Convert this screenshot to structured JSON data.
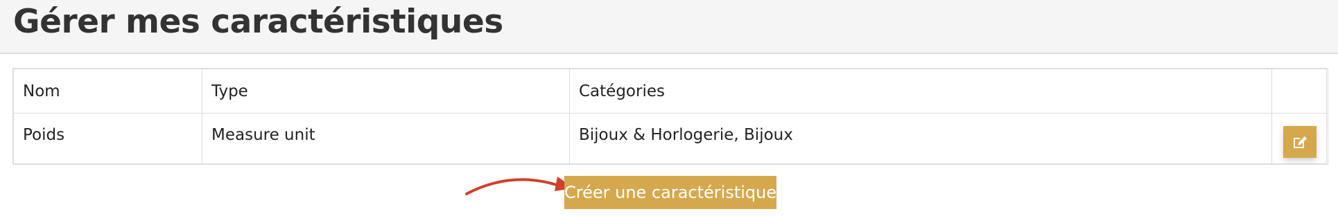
{
  "header": {
    "title": "Gérer mes caractéristiques"
  },
  "table": {
    "columns": [
      "Nom",
      "Type",
      "Catégories",
      ""
    ],
    "rows": [
      {
        "nom": "Poids",
        "type": "Measure unit",
        "categories": "Bijoux & Horlogerie, Bijoux"
      }
    ]
  },
  "actions": {
    "create_label": "Créer une caractéristique"
  },
  "icons": {
    "edit": "edit-icon",
    "arrow": "arrow-annotation-icon"
  },
  "colors": {
    "accent": "#d6a84e",
    "arrow": "#d0402a",
    "header_bg": "#f5f5f5"
  }
}
